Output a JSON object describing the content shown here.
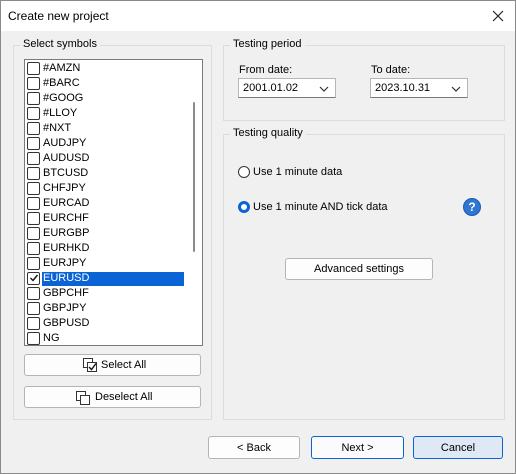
{
  "window": {
    "title": "Create new project",
    "close_glyph": "✕"
  },
  "symbols_group": {
    "label": "Select symbols",
    "items": [
      {
        "label": "#AMZN",
        "checked": false
      },
      {
        "label": "#BARC",
        "checked": false
      },
      {
        "label": "#GOOG",
        "checked": false
      },
      {
        "label": "#LLOY",
        "checked": false
      },
      {
        "label": "#NXT",
        "checked": false
      },
      {
        "label": "AUDJPY",
        "checked": false
      },
      {
        "label": "AUDUSD",
        "checked": false
      },
      {
        "label": "BTCUSD",
        "checked": false
      },
      {
        "label": "CHFJPY",
        "checked": false
      },
      {
        "label": "EURCAD",
        "checked": false
      },
      {
        "label": "EURCHF",
        "checked": false
      },
      {
        "label": "EURGBP",
        "checked": false
      },
      {
        "label": "EURHKD",
        "checked": false
      },
      {
        "label": "EURJPY",
        "checked": false
      },
      {
        "label": "EURUSD",
        "checked": true,
        "selected": true
      },
      {
        "label": "GBPCHF",
        "checked": false
      },
      {
        "label": "GBPJPY",
        "checked": false
      },
      {
        "label": "GBPUSD",
        "checked": false
      },
      {
        "label": "NG",
        "checked": false
      }
    ],
    "select_all_label": "Select All",
    "deselect_all_label": "Deselect All"
  },
  "testing_period": {
    "label": "Testing period",
    "from_label": "From date:",
    "from_value": "2001.01.02",
    "to_label": "To date:",
    "to_value": "2023.10.31"
  },
  "testing_quality": {
    "label": "Testing quality",
    "option_1": "Use 1 minute data",
    "option_2": "Use 1 minute AND tick data",
    "selected_option": 2,
    "advanced_label": "Advanced settings",
    "help_glyph": "?"
  },
  "footer": {
    "back_label": "< Back",
    "next_label": "Next >",
    "cancel_label": "Cancel"
  },
  "colors": {
    "accent": "#0a64d6",
    "selection": "#0a64d6",
    "help_icon": "#2f76d2"
  }
}
